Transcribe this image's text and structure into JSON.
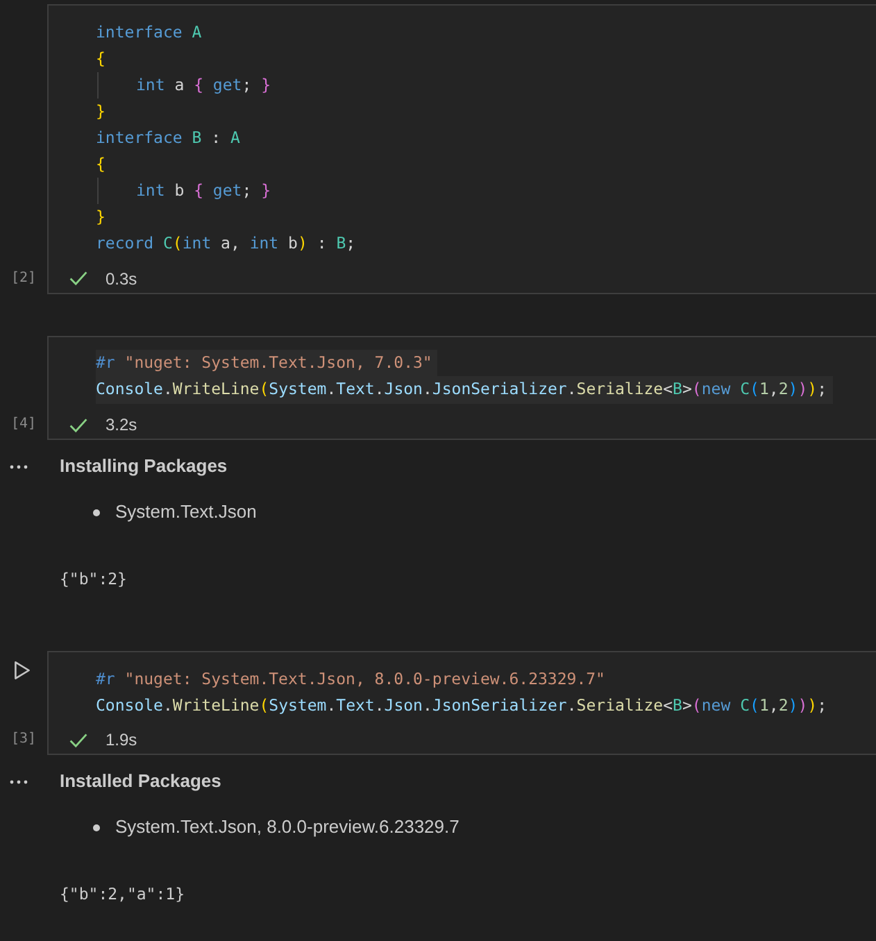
{
  "cells": [
    {
      "execution_count": "[2]",
      "hovered": false,
      "succeeded": true,
      "duration": "0.3s",
      "lines": [
        {
          "indented": false,
          "selected": false,
          "tokens": [
            {
              "kind": "keyword",
              "text": "interface"
            },
            {
              "kind": "type",
              "text": " A"
            }
          ]
        },
        {
          "indented": false,
          "selected": false,
          "tokens": [
            {
              "kind": "bracket1",
              "text": "{"
            }
          ]
        },
        {
          "indented": true,
          "selected": false,
          "tokens": [
            {
              "kind": "keyword",
              "text": "int"
            },
            {
              "kind": "plain",
              "text": " a "
            },
            {
              "kind": "bracket2",
              "text": "{"
            },
            {
              "kind": "keyword",
              "text": " get"
            },
            {
              "kind": "plain",
              "text": "; "
            },
            {
              "kind": "bracket2",
              "text": "}"
            }
          ]
        },
        {
          "indented": false,
          "selected": false,
          "tokens": [
            {
              "kind": "bracket1",
              "text": "}"
            }
          ]
        },
        {
          "indented": false,
          "selected": false,
          "tokens": [
            {
              "kind": "keyword",
              "text": "interface"
            },
            {
              "kind": "type",
              "text": " B"
            },
            {
              "kind": "plain",
              "text": " : "
            },
            {
              "kind": "type",
              "text": "A"
            }
          ]
        },
        {
          "indented": false,
          "selected": false,
          "tokens": [
            {
              "kind": "bracket1",
              "text": "{"
            }
          ]
        },
        {
          "indented": true,
          "selected": false,
          "tokens": [
            {
              "kind": "keyword",
              "text": "int"
            },
            {
              "kind": "plain",
              "text": " b "
            },
            {
              "kind": "bracket2",
              "text": "{"
            },
            {
              "kind": "keyword",
              "text": " get"
            },
            {
              "kind": "plain",
              "text": "; "
            },
            {
              "kind": "bracket2",
              "text": "}"
            }
          ]
        },
        {
          "indented": false,
          "selected": false,
          "tokens": [
            {
              "kind": "bracket1",
              "text": "}"
            }
          ]
        },
        {
          "indented": false,
          "selected": false,
          "tokens": [
            {
              "kind": "keyword",
              "text": "record"
            },
            {
              "kind": "type",
              "text": " C"
            },
            {
              "kind": "bracket1",
              "text": "("
            },
            {
              "kind": "keyword",
              "text": "int"
            },
            {
              "kind": "plain",
              "text": " a, "
            },
            {
              "kind": "keyword",
              "text": "int"
            },
            {
              "kind": "plain",
              "text": " b"
            },
            {
              "kind": "bracket1",
              "text": ")"
            },
            {
              "kind": "plain",
              "text": " : "
            },
            {
              "kind": "type",
              "text": "B"
            },
            {
              "kind": "plain",
              "text": ";"
            }
          ]
        }
      ]
    },
    {
      "execution_count": "[4]",
      "hovered": false,
      "succeeded": true,
      "duration": "3.2s",
      "lines": [
        {
          "indented": false,
          "selected": true,
          "tokens": [
            {
              "kind": "directive",
              "text": "#r"
            },
            {
              "kind": "string",
              "text": " \"nuget: System.Text.Json, 7.0.3\""
            }
          ]
        },
        {
          "indented": false,
          "selected": true,
          "tokens": [
            {
              "kind": "identifier",
              "text": "Console"
            },
            {
              "kind": "plain",
              "text": "."
            },
            {
              "kind": "method",
              "text": "WriteLine"
            },
            {
              "kind": "bracket1",
              "text": "("
            },
            {
              "kind": "identifier",
              "text": "System"
            },
            {
              "kind": "plain",
              "text": "."
            },
            {
              "kind": "identifier",
              "text": "Text"
            },
            {
              "kind": "plain",
              "text": "."
            },
            {
              "kind": "identifier",
              "text": "Json"
            },
            {
              "kind": "plain",
              "text": "."
            },
            {
              "kind": "identifier",
              "text": "JsonSerializer"
            },
            {
              "kind": "plain",
              "text": "."
            },
            {
              "kind": "method",
              "text": "Serialize"
            },
            {
              "kind": "plain",
              "text": "<"
            },
            {
              "kind": "type",
              "text": "B"
            },
            {
              "kind": "plain",
              "text": ">"
            },
            {
              "kind": "bracket2",
              "text": "("
            },
            {
              "kind": "keyword",
              "text": "new"
            },
            {
              "kind": "type",
              "text": " C"
            },
            {
              "kind": "bracket3",
              "text": "("
            },
            {
              "kind": "number",
              "text": "1"
            },
            {
              "kind": "plain",
              "text": ","
            },
            {
              "kind": "number",
              "text": "2"
            },
            {
              "kind": "bracket3",
              "text": ")"
            },
            {
              "kind": "bracket2",
              "text": ")"
            },
            {
              "kind": "bracket1",
              "text": ")"
            },
            {
              "kind": "plain",
              "text": ";"
            }
          ]
        }
      ],
      "outputs": [
        {
          "kind": "packages",
          "title": "Installing Packages",
          "items": [
            "System.Text.Json"
          ]
        },
        {
          "kind": "text",
          "text": "{\"b\":2}"
        }
      ]
    },
    {
      "execution_count": "[3]",
      "hovered": true,
      "succeeded": true,
      "duration": "1.9s",
      "lines": [
        {
          "indented": false,
          "selected": false,
          "tokens": [
            {
              "kind": "directive",
              "text": "#r"
            },
            {
              "kind": "string",
              "text": " \"nuget: System.Text.Json, 8.0.0-preview.6.23329.7\""
            }
          ]
        },
        {
          "indented": false,
          "selected": false,
          "tokens": [
            {
              "kind": "identifier",
              "text": "Console"
            },
            {
              "kind": "plain",
              "text": "."
            },
            {
              "kind": "method",
              "text": "WriteLine"
            },
            {
              "kind": "bracket1",
              "text": "("
            },
            {
              "kind": "identifier",
              "text": "System"
            },
            {
              "kind": "plain",
              "text": "."
            },
            {
              "kind": "identifier",
              "text": "Text"
            },
            {
              "kind": "plain",
              "text": "."
            },
            {
              "kind": "identifier",
              "text": "Json"
            },
            {
              "kind": "plain",
              "text": "."
            },
            {
              "kind": "identifier",
              "text": "JsonSerializer"
            },
            {
              "kind": "plain",
              "text": "."
            },
            {
              "kind": "method",
              "text": "Serialize"
            },
            {
              "kind": "plain",
              "text": "<"
            },
            {
              "kind": "type",
              "text": "B"
            },
            {
              "kind": "plain",
              "text": ">"
            },
            {
              "kind": "bracket2",
              "text": "("
            },
            {
              "kind": "keyword",
              "text": "new"
            },
            {
              "kind": "type",
              "text": " C"
            },
            {
              "kind": "bracket3",
              "text": "("
            },
            {
              "kind": "number",
              "text": "1"
            },
            {
              "kind": "plain",
              "text": ","
            },
            {
              "kind": "number",
              "text": "2"
            },
            {
              "kind": "bracket3",
              "text": ")"
            },
            {
              "kind": "bracket2",
              "text": ")"
            },
            {
              "kind": "bracket1",
              "text": ")"
            },
            {
              "kind": "plain",
              "text": ";"
            }
          ]
        }
      ],
      "outputs": [
        {
          "kind": "packages",
          "title": "Installed Packages",
          "items": [
            "System.Text.Json, 8.0.0-preview.6.23329.7"
          ]
        },
        {
          "kind": "text",
          "text": "{\"b\":2,\"a\":1}"
        }
      ]
    }
  ]
}
